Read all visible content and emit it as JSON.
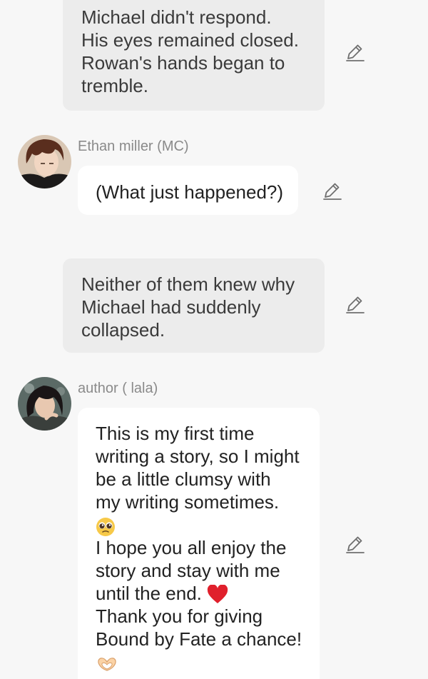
{
  "messages": [
    {
      "type": "narration",
      "text": "Michael didn't respond.\nHis eyes remained closed.\nRowan's hands began to\ntremble."
    },
    {
      "type": "character",
      "speaker": "Ethan miller (MC)",
      "text": "(What just happened?)"
    },
    {
      "type": "narration",
      "text": "Neither of them knew why\nMichael had suddenly\ncollapsed."
    },
    {
      "type": "character",
      "speaker": "author ( lala)",
      "lines": [
        "This is my first time",
        "writing a story, so I might",
        "be a little clumsy with",
        "my writing sometimes.",
        "I hope you all enjoy the",
        "story and stay with me",
        "until the end.",
        "Thank you for giving",
        "Bound by Fate a chance!"
      ],
      "emojis": [
        "pleading-face",
        "red-heart",
        "heart-hands"
      ]
    }
  ],
  "icons": {
    "edit": "pencil-edit-icon"
  },
  "colors": {
    "background": "#f7f7f7",
    "narration_bubble": "#ececec",
    "character_bubble": "#ffffff",
    "speaker_name": "#8a8a8a",
    "heart": "#e0202c"
  }
}
